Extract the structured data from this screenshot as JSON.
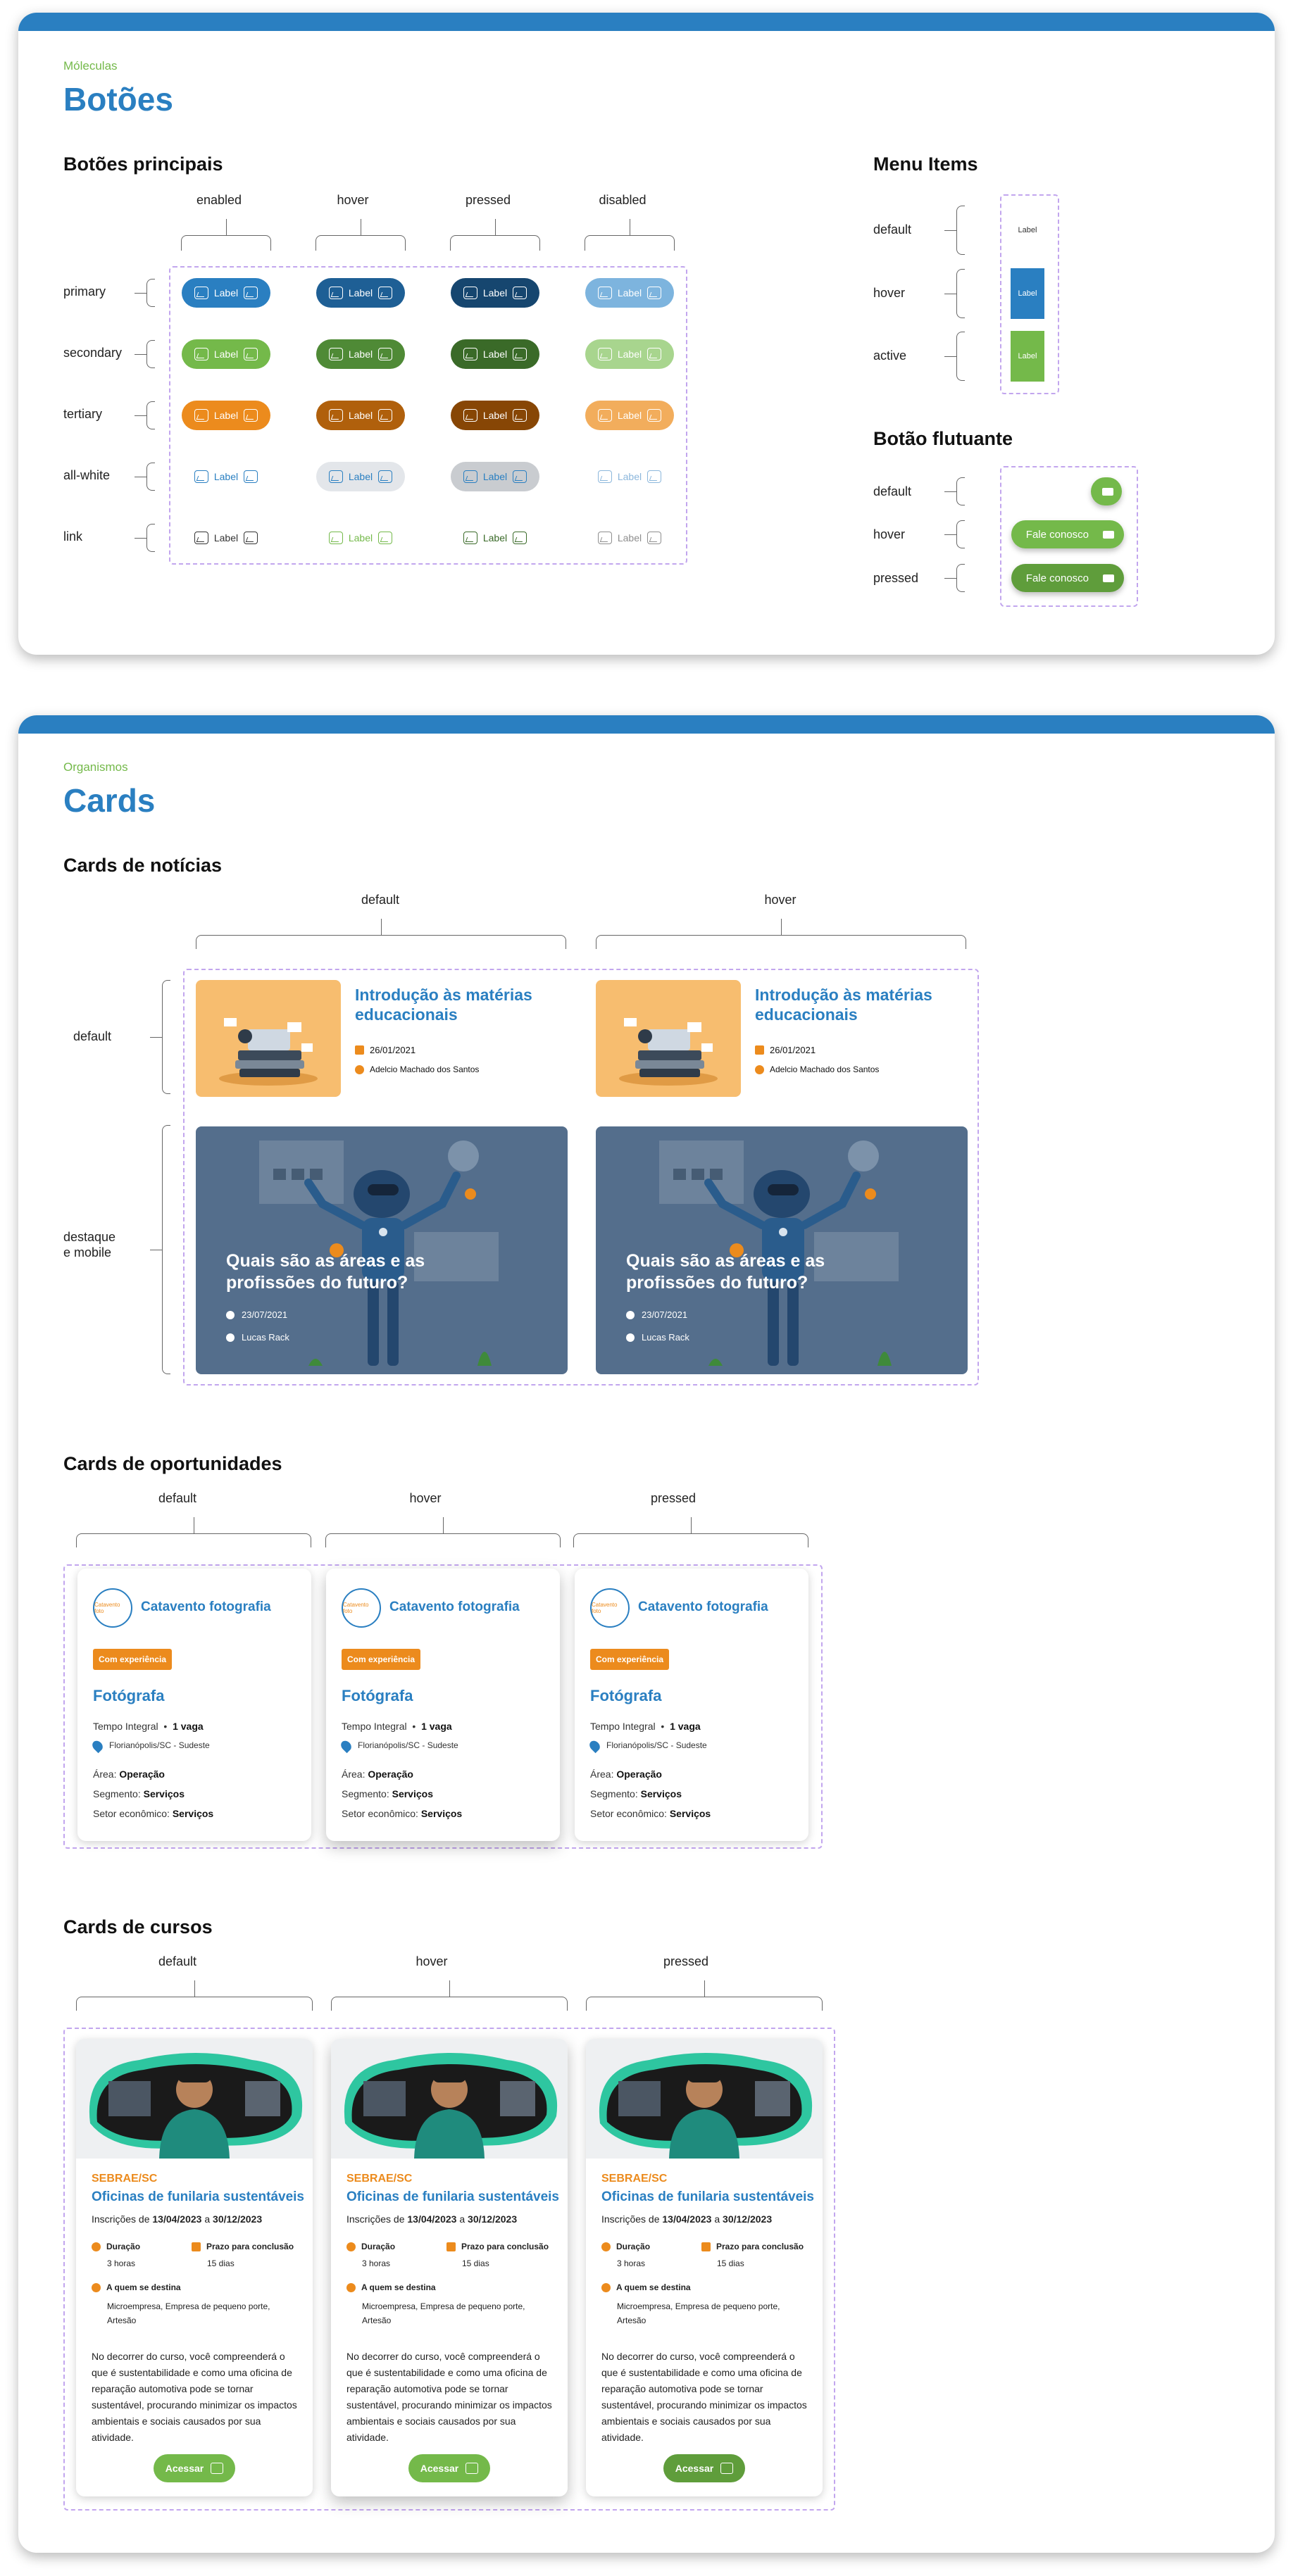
{
  "buttons_panel": {
    "eyebrow": "Móleculas",
    "title": "Botões",
    "main_heading": "Botões principais",
    "states": [
      "enabled",
      "hover",
      "pressed",
      "disabled"
    ],
    "variants": [
      "primary",
      "secondary",
      "tertiary",
      "all-white",
      "link"
    ],
    "button_label": "Label",
    "menu_heading": "Menu Items",
    "menu_states": [
      "default",
      "hover",
      "active"
    ],
    "menu_label": "Label",
    "fab_heading": "Botão flutuante",
    "fab_states": [
      "default",
      "hover",
      "pressed"
    ],
    "fab_label": "Fale conosco"
  },
  "cards_panel": {
    "eyebrow": "Organismos",
    "title": "Cards",
    "news_heading": "Cards de notícias",
    "news_states": [
      "default",
      "hover"
    ],
    "news_rows": [
      "default",
      "destaque\ne mobile"
    ],
    "news_card": {
      "title": "Introdução às matérias educacionais",
      "date": "26/01/2021",
      "author": "Adelcio Machado dos Santos"
    },
    "featured_card": {
      "title": "Quais são as áreas e as profissões do futuro?",
      "date": "23/07/2021",
      "author": "Lucas Rack"
    },
    "opp_heading": "Cards de oportunidades",
    "opp_states": [
      "default",
      "hover",
      "pressed"
    ],
    "opp_card": {
      "company": "Catavento fotografia",
      "logo_text": "Catavento foto",
      "tag": "Com experiência",
      "role": "Fotógrafa",
      "schedule": "Tempo Integral",
      "vacancies": "1 vaga",
      "location": "Florianópolis/SC - Sudeste",
      "area_label": "Área:",
      "area": "Operação",
      "segment_label": "Segmento:",
      "segment": "Serviços",
      "sector_label": "Setor econômico:",
      "sector": "Serviços"
    },
    "course_heading": "Cards de cursos",
    "course_states": [
      "default",
      "hover",
      "pressed"
    ],
    "course_card": {
      "org": "SEBRAE/SC",
      "name": "Oficinas de funilaria sustentáveis",
      "enroll_prefix": "Inscrições de",
      "enroll_start": "13/04/2023",
      "enroll_mid": "a",
      "enroll_end": "30/12/2023",
      "duration_label": "Duração",
      "duration": "3 horas",
      "deadline_label": "Prazo para conclusão",
      "deadline": "15 dias",
      "audience_label": "A quem se destina",
      "audience": "Microempresa, Empresa de pequeno porte, Artesão",
      "description": "No decorrer do curso, você compreenderá o que é sustentabilidade e como uma oficina de reparação automotiva pode se tornar sustentável, procurando minimizar os impactos ambientais e sociais causados por sua atividade.",
      "cta": "Acessar"
    }
  },
  "colors": {
    "primary": "#2a7fc1",
    "secondary": "#74b94a",
    "tertiary": "#ec8b1d",
    "accent_dash": "#c2a6ee"
  }
}
